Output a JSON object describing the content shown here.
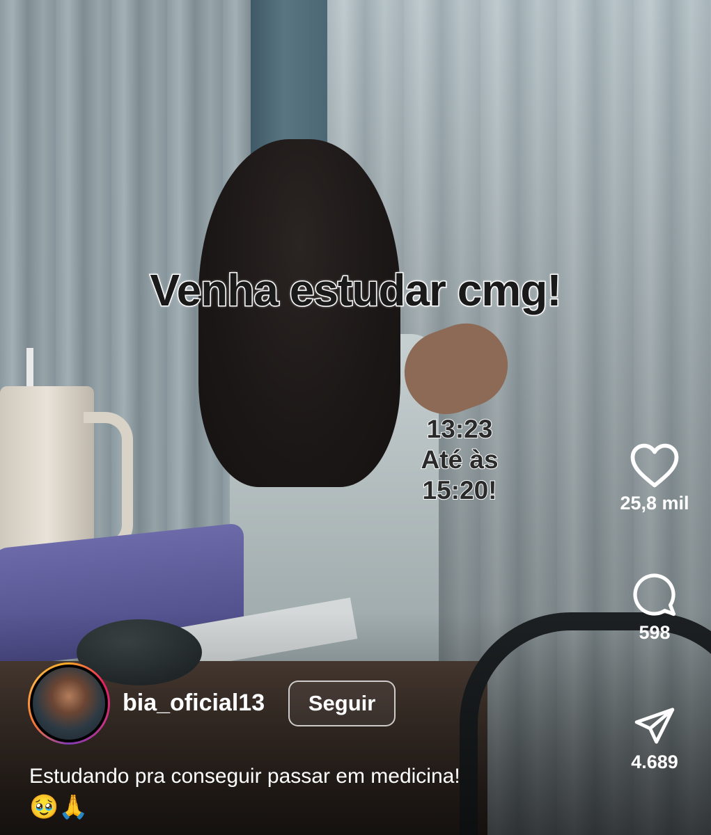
{
  "video": {
    "overlay_title": "Venha estudar cmg!",
    "overlay_time_lines": [
      "13:23",
      "Até às",
      "15:20!"
    ]
  },
  "actions": {
    "like": {
      "icon": "heart-icon",
      "count": "25,8 mil"
    },
    "comment": {
      "icon": "comment-icon",
      "count": "598"
    },
    "share": {
      "icon": "send-icon",
      "count": "4.689"
    }
  },
  "author": {
    "username": "bia_oficial13",
    "follow_label": "Seguir"
  },
  "caption": {
    "text": "Estudando pra conseguir passar em medicina!",
    "emojis": "🥹🙏"
  }
}
